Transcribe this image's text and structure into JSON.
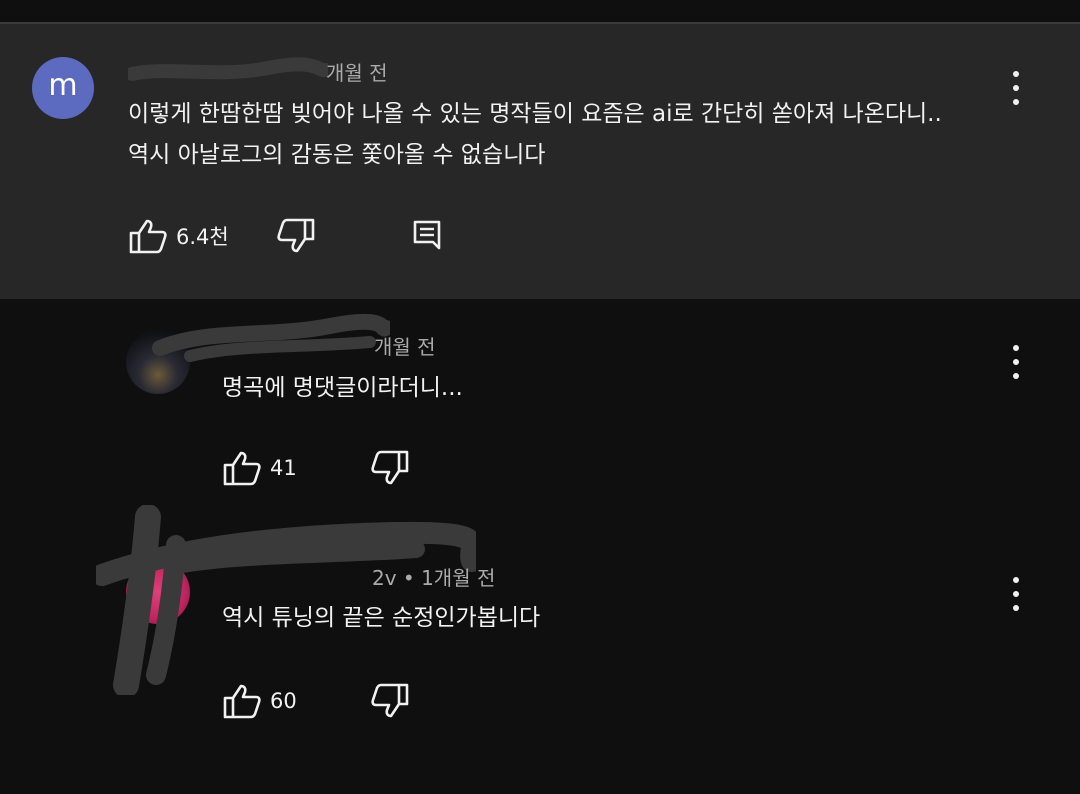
{
  "comments": [
    {
      "avatar_letter": "m",
      "time": "개월 전",
      "lines": [
        "이렇게 한땀한땀 빚어야 나올 수 있는 명작들이 요즘은 ai로 간단히 쏟아져 나온다니..",
        "역시 아날로그의 감동은 쫓아올 수 없습니다"
      ],
      "likes": "6.4천"
    },
    {
      "time": "개월 전",
      "lines": [
        "명곡에 명댓글이라더니..."
      ],
      "likes": "41"
    },
    {
      "time": "2v • 1개월 전",
      "lines": [
        "역시 튜닝의 끝은 순정인가봅니다"
      ],
      "likes": "60"
    }
  ],
  "colors": {
    "background": "#0f0f0f",
    "highlight": "#272727",
    "avatar_m": "#5c6bc0",
    "avatar_pink": "#c02460",
    "scribble": "#3a3a3a"
  },
  "icons": [
    "like-icon",
    "dislike-icon",
    "reply-icon",
    "more-vert-icon"
  ]
}
